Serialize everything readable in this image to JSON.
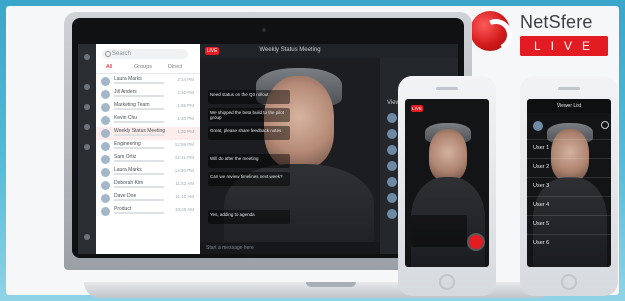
{
  "brand": {
    "name": "NetSfere",
    "badge": "LIVE",
    "accent": "#e31b23"
  },
  "desktop_app": {
    "stream_title": "Weekly Status Meeting",
    "live_badge": "LIVE",
    "search_placeholder": "Search",
    "conversation_tabs": [
      "All",
      "Groups",
      "Direct"
    ],
    "composer_placeholder": "Start a message here",
    "conversations": [
      {
        "name": "Laura Marks",
        "time": "2:14 PM"
      },
      {
        "name": "Jill Anders",
        "time": "2:10 PM"
      },
      {
        "name": "Marketing Team",
        "time": "1:55 PM"
      },
      {
        "name": "Kevin Chu",
        "time": "1:40 PM"
      },
      {
        "name": "Weekly Status Meeting",
        "time": "1:32 PM"
      },
      {
        "name": "Engineering",
        "time": "12:58 PM"
      },
      {
        "name": "Sam Ortiz",
        "time": "12:41 PM"
      },
      {
        "name": "Laura Marks",
        "time": "12:30 PM"
      },
      {
        "name": "Deborah Kim",
        "time": "11:52 AM"
      },
      {
        "name": "Dave Doe",
        "time": "11:10 AM"
      },
      {
        "name": "Product",
        "time": "10:45 AM"
      }
    ],
    "chat_messages": [
      "Need status on the Q3 rollout",
      "We shipped the beta build to the pilot group",
      "Great, please share feedback notes",
      "Will do after the meeting",
      "Can we review timelines next week?",
      "Yes, adding to agenda"
    ],
    "right_panel_title": "Viewers"
  },
  "phone_1": {
    "live_badge": "LIVE"
  },
  "phone_2": {
    "title": "Viewer List",
    "list": [
      "User 1",
      "User 2",
      "User 3",
      "User 4",
      "User 5",
      "User 6"
    ]
  },
  "colors": {
    "page_background": "#3aa6c9",
    "card_background": "#f6f7f8"
  }
}
